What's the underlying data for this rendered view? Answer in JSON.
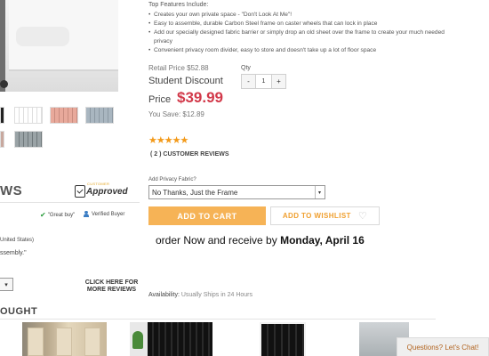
{
  "product": {
    "features_title": "Top Features Include:",
    "features": [
      "Creates your own private space - \"Don't Look At Me\"!",
      "Easy to assemble, durable Carbon Steel frame on caster wheels that can lock in place",
      "Add our specially designed fabric barrier or simply drop an old sheet over the frame to create your much needed privacy",
      "Convenient privacy room divider, easy to store and doesn't take up a lot of floor space"
    ],
    "retail_price": "Retail Price $52.88",
    "student_discount": "Student Discount",
    "price_label": "Price",
    "price": "$39.99",
    "you_save": "You Save: $12.89",
    "qty_label": "Qty",
    "qty_minus": "-",
    "qty_value": "1",
    "qty_plus": "+",
    "rating_stars": "★★★★★",
    "rating_value": 5,
    "reviews_link": "( 2 ) CUSTOMER REVIEWS",
    "fabric_label": "Add Privacy Fabric?",
    "fabric_selected": "No Thanks, Just the Frame",
    "add_to_cart": "ADD TO CART",
    "add_to_wishlist": "ADD TO WISHLIST",
    "order_prefix": "order Now and receive by ",
    "order_date": "Monday, April 16",
    "availability_label": "Availability:",
    "availability_value": "Usually Ships in 24 Hours"
  },
  "reviews": {
    "heading_fragment": "WS",
    "badge_small": "CUSTOMER",
    "badge_text": "Approved",
    "great_buy": "\"Great buy\"",
    "verified": "Verified Buyer",
    "location_fragment": "United States)",
    "snippet_fragment": "ssembly.\"",
    "more_reviews": "CLICK HERE FOR MORE REVIEWS"
  },
  "bottom": {
    "heading_fragment": "OUGHT"
  },
  "chat": {
    "label": "Questions? Let's Chat!"
  },
  "colors": {
    "price_red": "#d2394a",
    "cart_orange": "#f6b356",
    "star_orange": "#f39a1a",
    "wishlist_text": "#f0a030",
    "chat_text": "#b1621d"
  },
  "icons": [
    "approved-check-icon",
    "check-icon",
    "person-icon",
    "heart-icon",
    "chevron-down-icon",
    "star-icon"
  ]
}
